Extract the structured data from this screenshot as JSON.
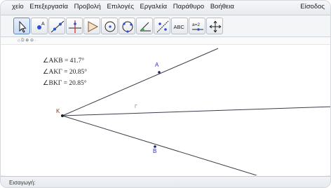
{
  "menubar": {
    "items": [
      "χείο",
      "Επεξεργασία",
      "Προβολή",
      "Επιλογές",
      "Εργαλεία",
      "Παράθυρο",
      "Βοήθεια"
    ],
    "right_label": "Είσοδος"
  },
  "toolbar": {
    "tools": [
      {
        "name": "move-tool",
        "icon": "arrow-pointer-icon"
      },
      {
        "name": "new-point-tool",
        "icon": "point-icon"
      },
      {
        "name": "line-tool",
        "icon": "line-through-points-icon"
      },
      {
        "name": "perpendicular-line-tool",
        "icon": "perpendicular-icon"
      },
      {
        "name": "polygon-tool",
        "icon": "polygon-icon"
      },
      {
        "name": "circle-tool",
        "icon": "circle-center-point-icon"
      },
      {
        "name": "circle-three-points-tool",
        "icon": "circle-three-points-icon"
      },
      {
        "name": "angle-tool",
        "icon": "angle-icon"
      },
      {
        "name": "reflect-tool",
        "icon": "reflect-icon"
      },
      {
        "name": "text-tool",
        "icon": "text-abc-icon",
        "label": "ABC"
      },
      {
        "name": "slider-tool",
        "icon": "slider-icon",
        "label": "a=2"
      },
      {
        "name": "move-view-tool",
        "icon": "move-graphics-icon"
      }
    ]
  },
  "sub_strip_text": "⌂ D ⊕ ⊖ ·",
  "canvas": {
    "measurements": [
      "∠ΑΚΒ = 41.7°",
      "∠ΑΚΓ = 20.85°",
      "∠ΒΚΓ = 20.85°"
    ],
    "points": {
      "A": "A",
      "B": "B",
      "K": "K",
      "Gamma": "Γ"
    },
    "colors": {
      "point_label": "#2b2bd6",
      "line": "#3b3b4a",
      "k_label": "#7a3d2b"
    }
  },
  "input_bar": {
    "label": "Εισαγωγή:"
  }
}
